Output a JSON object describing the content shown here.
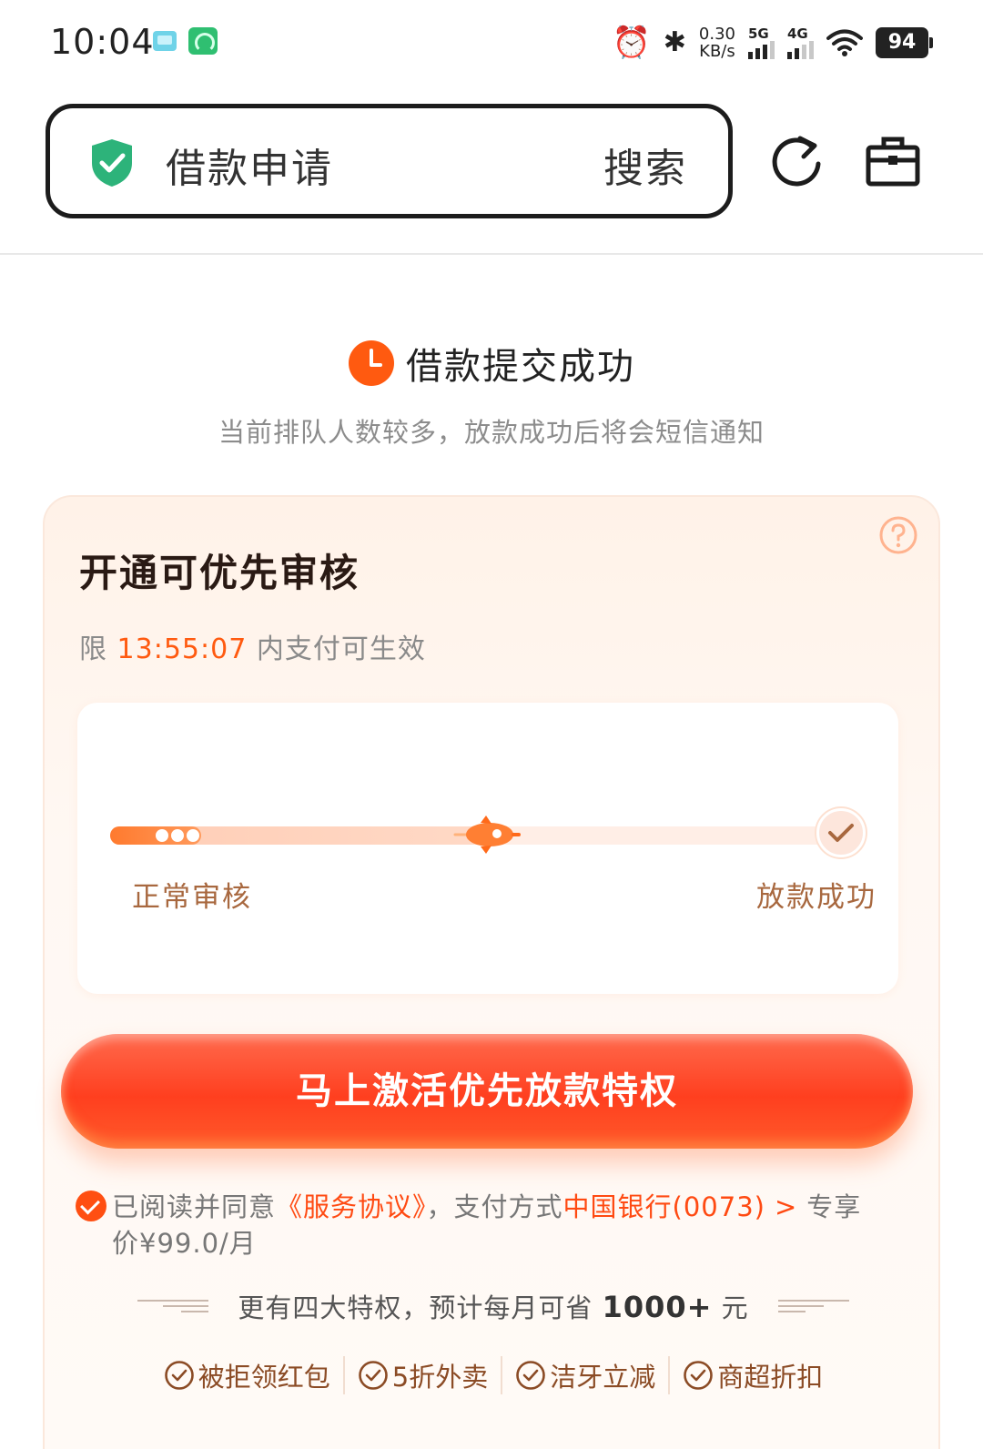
{
  "status_bar": {
    "time": "10:04",
    "alarm_icon": "alarm-icon",
    "bluetooth_icon": "bluetooth-icon",
    "net_speed_value": "0.30",
    "net_speed_unit": "KB/s",
    "signal_1": "5G",
    "signal_2": "4G",
    "wifi_icon": "wifi-icon",
    "battery": "94"
  },
  "header": {
    "search_text": "借款申请",
    "search_button": "搜索",
    "shield_color": "#2db37a"
  },
  "status": {
    "title": "借款提交成功",
    "subtitle": "当前排队人数较多，放款成功后将会短信通知",
    "accent": "#ff5a10"
  },
  "card": {
    "title": "开通可优先审核",
    "countdown_prefix": "限",
    "countdown_time": "13:55:07",
    "countdown_suffix": "内支付可生效",
    "progress": {
      "fraction": 0.5,
      "start_label": "正常审核",
      "end_label": "放款成功"
    },
    "cta_label": "马上激活优先放款特权",
    "agreement": {
      "prefix": "已阅读并同意",
      "link": "《服务协议》",
      "mid": "，支付方式",
      "bank": "中国银行(0073)",
      "arrow": ">",
      "suffix": "专享",
      "price": "价¥99.0/月"
    },
    "perk_prefix": "更有四大特权，预计每月可省",
    "perk_amount": "1000+",
    "perk_unit": "元",
    "benefits": [
      "被拒领红包",
      "5折外卖",
      "洁牙立减",
      "商超折扣"
    ]
  }
}
